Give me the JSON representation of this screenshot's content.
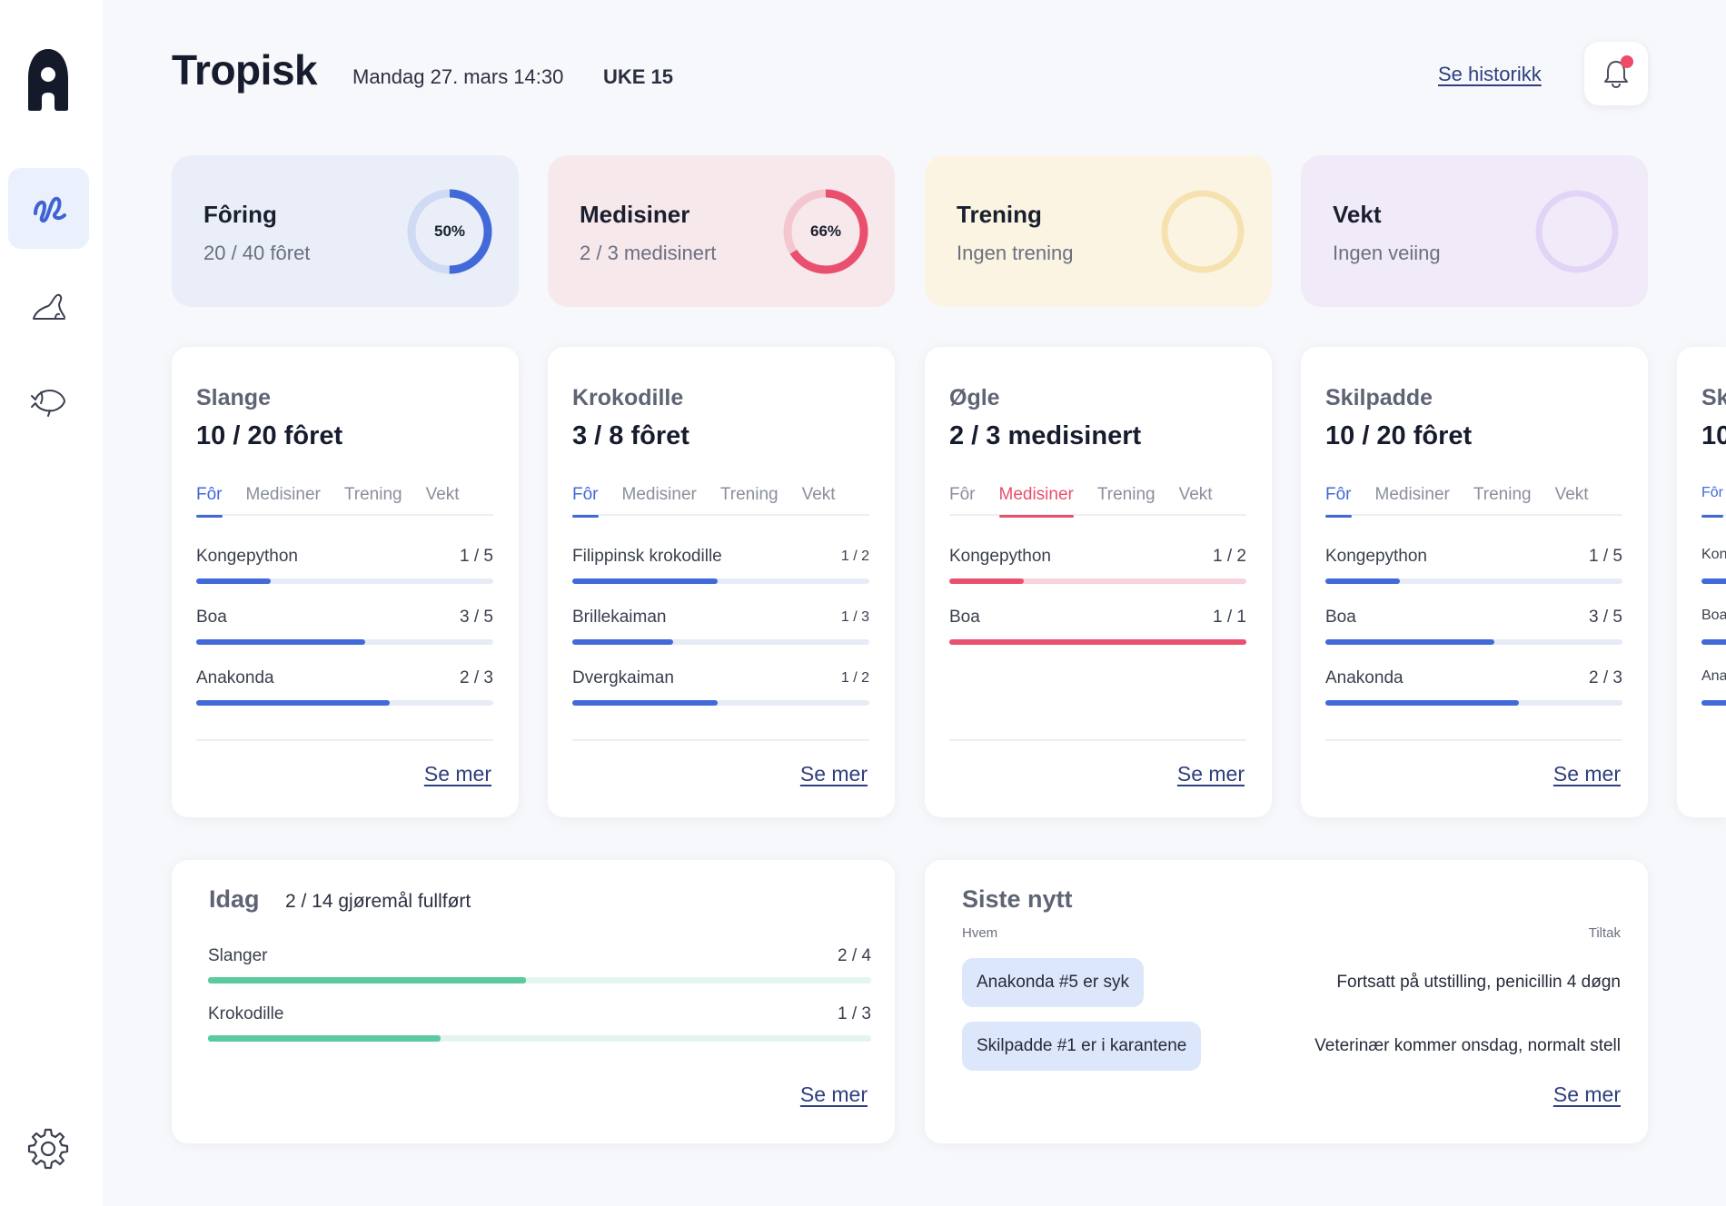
{
  "header": {
    "title": "Tropisk",
    "date": "Mandag 27. mars 14:30",
    "week": "UKE 15",
    "history_link": "Se historikk"
  },
  "colors": {
    "primary_blue": "#4169d8",
    "accent_red": "#e8506e",
    "accent_green": "#5ccaa0",
    "link": "#2f3f7e"
  },
  "sidebar": {
    "items": [
      {
        "icon": "snake-icon",
        "active": true
      },
      {
        "icon": "seal-icon",
        "active": false
      },
      {
        "icon": "fish-icon",
        "active": false
      }
    ],
    "settings_icon": "gear-icon"
  },
  "stats": [
    {
      "title": "Fôring",
      "subtitle": "20 / 40 fôret",
      "percent_label": "50%",
      "value": 0.5
    },
    {
      "title": "Medisiner",
      "subtitle": "2 / 3 medisinert",
      "percent_label": "66%",
      "value": 0.66
    },
    {
      "title": "Trening",
      "subtitle": "Ingen trening",
      "percent_label": "",
      "value": 0
    },
    {
      "title": "Vekt",
      "subtitle": "Ingen veiing",
      "percent_label": "",
      "value": 0
    }
  ],
  "tabs": [
    "Fôr",
    "Medisiner",
    "Trening",
    "Vekt"
  ],
  "groups": [
    {
      "name": "Slange",
      "status": "10 / 20 fôret",
      "active_tab": 0,
      "rows": [
        {
          "name": "Kongepython",
          "count": "1 / 5",
          "value": 0.25
        },
        {
          "name": "Boa",
          "count": "3 / 5",
          "value": 0.57
        },
        {
          "name": "Anakonda",
          "count": "2 / 3",
          "value": 0.65
        }
      ],
      "link": "Se mer"
    },
    {
      "name": "Krokodille",
      "status": "3 / 8 fôret",
      "active_tab": 0,
      "rows": [
        {
          "name": "Filippinsk krokodille",
          "count": "1 / 2",
          "value": 0.49
        },
        {
          "name": "Brillekaiman",
          "count": "1 / 3",
          "value": 0.34
        },
        {
          "name": "Dvergkaiman",
          "count": "1 / 2",
          "value": 0.49
        }
      ],
      "link": "Se mer"
    },
    {
      "name": "Øgle",
      "status": "2 / 3 medisinert",
      "active_tab": 1,
      "rows": [
        {
          "name": "Kongepython",
          "count": "1 / 2",
          "value": 0.25
        },
        {
          "name": "Boa",
          "count": "1 / 1",
          "value": 1.0
        }
      ],
      "link": "Se mer"
    },
    {
      "name": "Skilpadde",
      "status": "10 / 20 fôret",
      "active_tab": 0,
      "rows": [
        {
          "name": "Kongepython",
          "count": "1 / 5",
          "value": 0.25
        },
        {
          "name": "Boa",
          "count": "3 / 5",
          "value": 0.57
        },
        {
          "name": "Anakonda",
          "count": "2 / 3",
          "value": 0.65
        }
      ],
      "link": "Se mer"
    },
    {
      "name": "Sk",
      "status": "10",
      "active_tab": 0,
      "rows": [
        {
          "name": "Kon",
          "count": "",
          "value": 0.25
        },
        {
          "name": "Boa",
          "count": "",
          "value": 0.57
        },
        {
          "name": "Ana",
          "count": "",
          "value": 0.65
        }
      ],
      "link": ""
    }
  ],
  "today": {
    "title": "Idag",
    "subtitle": "2 / 14 gjøremål fullført",
    "rows": [
      {
        "name": "Slanger",
        "count": "2 / 4",
        "value": 0.48
      },
      {
        "name": "Krokodille",
        "count": "1 / 3",
        "value": 0.35
      }
    ],
    "link": "Se mer"
  },
  "news": {
    "title": "Siste nytt",
    "col_who": "Hvem",
    "col_action": "Tiltak",
    "items": [
      {
        "who": "Anakonda #5 er syk",
        "action": "Fortsatt på utstilling, penicillin 4 døgn"
      },
      {
        "who": "Skilpadde #1 er i karantene",
        "action": "Veterinær kommer onsdag, normalt stell"
      }
    ],
    "link": "Se mer"
  }
}
